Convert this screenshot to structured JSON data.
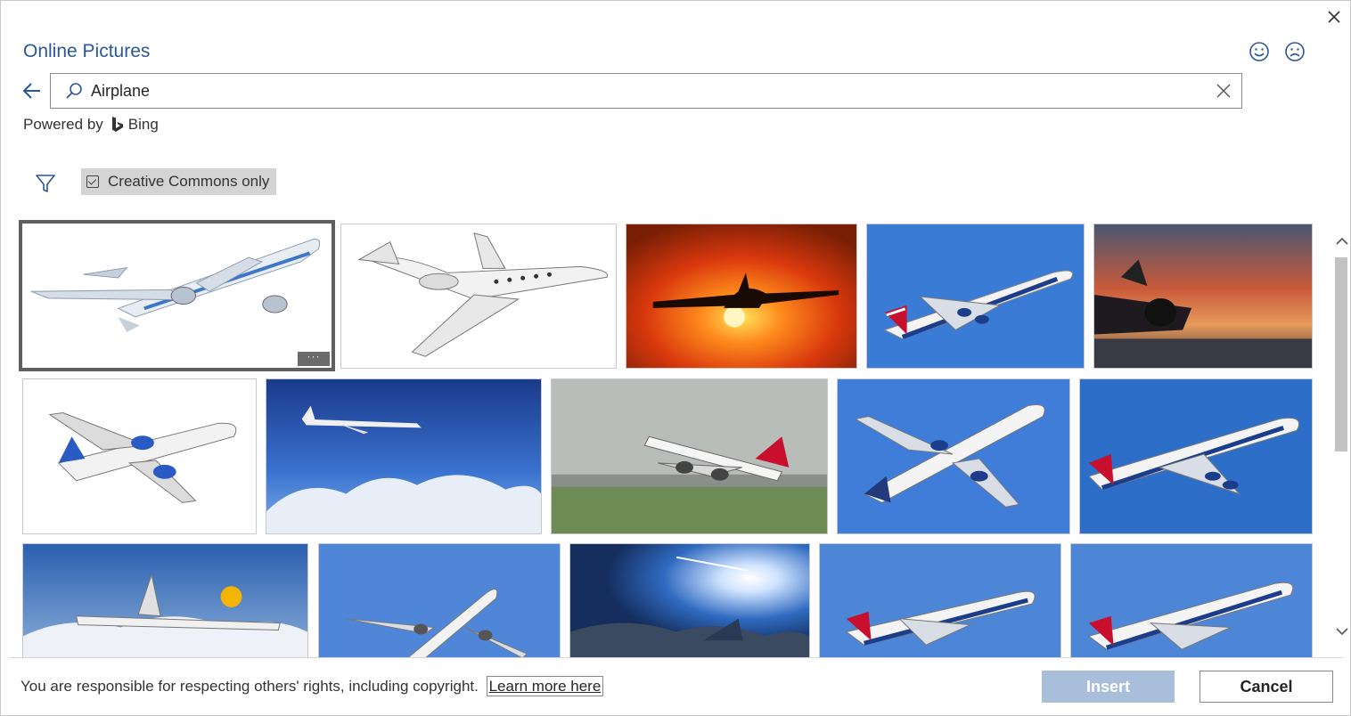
{
  "dialog": {
    "title": "Online Pictures",
    "close_icon": "close-icon",
    "feedback": {
      "smile_icon": "smile-icon",
      "frown_icon": "frown-icon"
    }
  },
  "search": {
    "value": "Airplane",
    "back_icon": "back-arrow-icon",
    "search_icon": "search-icon",
    "clear_icon": "clear-icon"
  },
  "powered_by": {
    "label": "Powered by",
    "brand": "Bing"
  },
  "filters": {
    "filter_icon": "filter-icon",
    "cc_label": "Creative Commons only",
    "cc_checked": true
  },
  "results": [
    {
      "id": "t1",
      "kind": "white-jet",
      "selected": true,
      "more_label": "···"
    },
    {
      "id": "t2",
      "kind": "business-jet"
    },
    {
      "id": "t3",
      "kind": "sunset-silhouette"
    },
    {
      "id": "t4",
      "kind": "british-747"
    },
    {
      "id": "t5",
      "kind": "jet-sunset-ground"
    },
    {
      "id": "t6",
      "kind": "blue-tail-jet"
    },
    {
      "id": "t7",
      "kind": "jet-above-clouds"
    },
    {
      "id": "t8",
      "kind": "red-tail-takeoff"
    },
    {
      "id": "t9",
      "kind": "delta-jet"
    },
    {
      "id": "t10",
      "kind": "oneworld-747"
    },
    {
      "id": "t11",
      "kind": "lufthansa-clouds"
    },
    {
      "id": "t12",
      "kind": "jet-climbing"
    },
    {
      "id": "t13",
      "kind": "sun-sky"
    },
    {
      "id": "t14",
      "kind": "british-747"
    },
    {
      "id": "t15",
      "kind": "british-747"
    }
  ],
  "footer": {
    "notice": "You are responsible for respecting others' rights, including copyright.",
    "learn_more": "Learn more here",
    "insert_label": "Insert",
    "cancel_label": "Cancel"
  },
  "colors": {
    "accent": "#2b579a",
    "insert_disabled": "#a8bedb",
    "sky_blue": "#3a7bd5",
    "sunset_orange": "#e8551c"
  }
}
